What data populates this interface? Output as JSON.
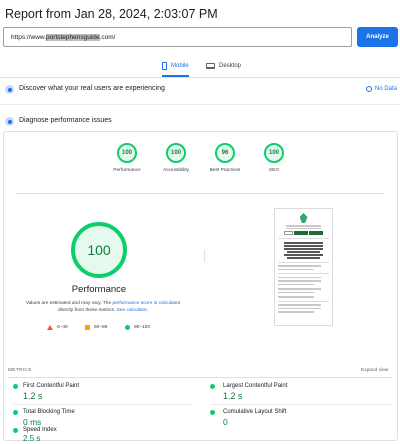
{
  "header": {
    "title": "Report from Jan 28, 2024, 2:03:07 PM"
  },
  "url_bar": {
    "prefix": "https://www.",
    "highlighted": "portstephensguide",
    "suffix": ".com/",
    "analyze_label": "Analyze",
    "analyze_color": "#1a73e8"
  },
  "tabs": [
    {
      "label": "Mobile",
      "icon": "mobile-phone-icon",
      "active": true
    },
    {
      "label": "Desktop",
      "icon": "desktop-monitor-icon",
      "active": false
    }
  ],
  "sections": {
    "real_users": "Discover what your real users are experiencing",
    "no_data": "No Data",
    "diagnose": "Diagnose performance issues"
  },
  "category_scores": [
    {
      "label": "Performance",
      "score": "100"
    },
    {
      "label": "Accessibility",
      "score": "100"
    },
    {
      "label": "Best Practices",
      "score": "96"
    },
    {
      "label": "SEO",
      "score": "100"
    }
  ],
  "performance": {
    "score": "100",
    "label": "Performance",
    "desc_1": "Values are estimated and may vary. The ",
    "desc_link_1": "performance score is calculated",
    "desc_2": " directly from these metrics. ",
    "desc_link_2": "See calculator."
  },
  "legend": [
    {
      "range": "0–49",
      "shape": "triangle-icon",
      "color": "#ff4e42"
    },
    {
      "range": "50–89",
      "shape": "square-icon",
      "color": "#ffa400"
    },
    {
      "range": "90–100",
      "shape": "circle-icon",
      "color": "#0cce6b"
    }
  ],
  "metrics": {
    "title": "METRICS",
    "expand_label": "Expand view",
    "items": [
      {
        "name": "First Contentful Paint",
        "value": "1.2 s"
      },
      {
        "name": "Largest Contentful Paint",
        "value": "1.2 s"
      },
      {
        "name": "Total Blocking Time",
        "value": "0 ms"
      },
      {
        "name": "Cumulative Layout Shift",
        "value": "0"
      },
      {
        "name": "Speed Index",
        "value": "2.5 s"
      }
    ]
  },
  "colors": {
    "good": "#0cce6b",
    "good_text": "#0d8043",
    "accent": "#1a73e8"
  }
}
